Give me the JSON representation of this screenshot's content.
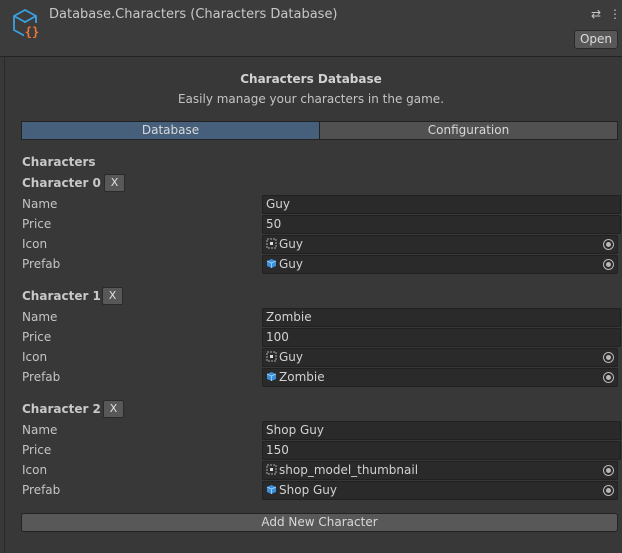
{
  "header": {
    "title": "Database.Characters (Characters Database)",
    "asset_icon": "scriptable-object-icon",
    "settings_icon": "sliders-icon",
    "more_icon": "vertical-ellipsis-icon",
    "open_label": "Open"
  },
  "inspector": {
    "title": "Characters Database",
    "subtitle": "Easily manage your characters in the game.",
    "tabs": [
      {
        "label": "Database",
        "selected": true
      },
      {
        "label": "Configuration",
        "selected": false
      }
    ],
    "section_label": "Characters",
    "remove_label": "X",
    "field_labels": {
      "name": "Name",
      "price": "Price",
      "icon": "Icon",
      "prefab": "Prefab"
    },
    "characters": [
      {
        "header": "Character 0",
        "name": "Guy",
        "price": "50",
        "icon": "Guy",
        "prefab": "Guy"
      },
      {
        "header": "Character 1",
        "name": "Zombie",
        "price": "100",
        "icon": "Guy",
        "prefab": "Zombie"
      },
      {
        "header": "Character 2",
        "name": "Shop Guy",
        "price": "150",
        "icon": "shop_model_thumbnail",
        "prefab": "Shop Guy"
      }
    ],
    "add_label": "Add New Character"
  },
  "colors": {
    "background": "#383838",
    "field_background": "#2a2a2a",
    "selected_tab": "#46607c",
    "button": "#585858",
    "icon_orange": "#e8783a",
    "icon_blue": "#3aa0e0"
  }
}
